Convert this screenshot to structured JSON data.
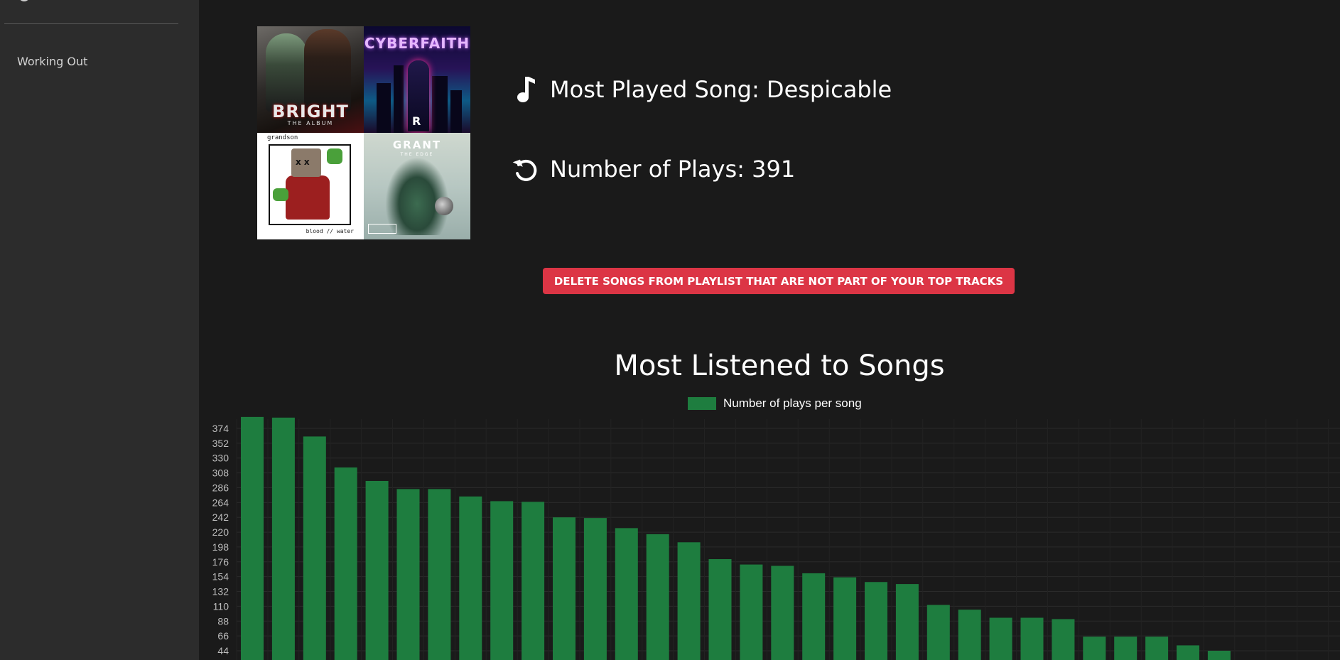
{
  "sidebar": {
    "playlists": [
      "Working Out"
    ]
  },
  "album_covers": [
    {
      "title": "BRIGHT",
      "subtitle": "THE ALBUM",
      "icon": "album-cover-bright"
    },
    {
      "title": "CYBERFAITH",
      "subtitle": "R",
      "icon": "album-cover-cyberfaith"
    },
    {
      "title": "grandson",
      "subtitle": "blood // water",
      "icon": "album-cover-blood-water"
    },
    {
      "title": "GRANT",
      "subtitle": "THE EDGE",
      "icon": "album-cover-grant"
    }
  ],
  "stats": {
    "most_played_label": "Most Played Song: Despicable",
    "plays_label": "Number of Plays: 391",
    "song_icon": "music-note-icon",
    "plays_icon": "replay-icon"
  },
  "actions": {
    "delete_label": "DELETE SONGS FROM PLAYLIST THAT ARE NOT PART OF YOUR TOP TRACKS",
    "delete_color": "#dc3545"
  },
  "chart_data": {
    "type": "bar",
    "title": "Most Listened to Songs",
    "series": [
      {
        "name": "Number of plays per song",
        "color": "#1e7d3f",
        "values": [
          391,
          390,
          362,
          316,
          296,
          284,
          284,
          273,
          266,
          265,
          242,
          241,
          226,
          217,
          205,
          180,
          172,
          170,
          159,
          153,
          146,
          143,
          112,
          105,
          93,
          93,
          91,
          65,
          65,
          65,
          52,
          44
        ]
      }
    ],
    "y_ticks": [
      374,
      352,
      330,
      308,
      286,
      264,
      242,
      220,
      198,
      176,
      154,
      132,
      110,
      88,
      66,
      44
    ],
    "grid": true,
    "legend_position": "top-center"
  }
}
